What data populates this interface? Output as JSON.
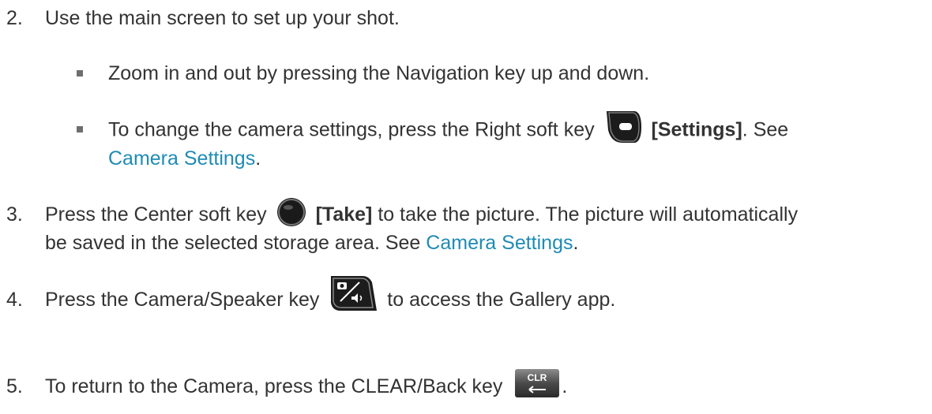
{
  "steps": [
    {
      "number": "2.",
      "text": "Use the main screen to set up your shot.",
      "bullets": [
        {
          "text": "Zoom in and out by pressing the Navigation key up and down."
        },
        {
          "before": "To change the camera settings, press the Right soft key",
          "bold": "[Settings]",
          "after": ". See",
          "link": "Camera Settings",
          "end": "."
        }
      ]
    },
    {
      "number": "3.",
      "before": "Press the Center soft key",
      "bold": "[Take]",
      "after": "to take the picture. The picture will automatically",
      "line2": "be saved in the selected storage area. See",
      "link": "Camera Settings",
      "end": "."
    },
    {
      "number": "4.",
      "before": "Press the Camera/Speaker key",
      "after": "to access the Gallery app."
    },
    {
      "number": "5.",
      "before": "To return to the Camera, press the CLEAR/Back key",
      "key_label": "CLR",
      "end": "."
    }
  ],
  "icons": {
    "right_soft_key": "right-soft-key-icon",
    "center_soft_key": "center-soft-key-icon",
    "camera_speaker_key": "camera-speaker-key-icon",
    "clear_back_key": "clear-back-key-icon"
  },
  "colors": {
    "text": "#333333",
    "link": "#1f8bb5"
  }
}
